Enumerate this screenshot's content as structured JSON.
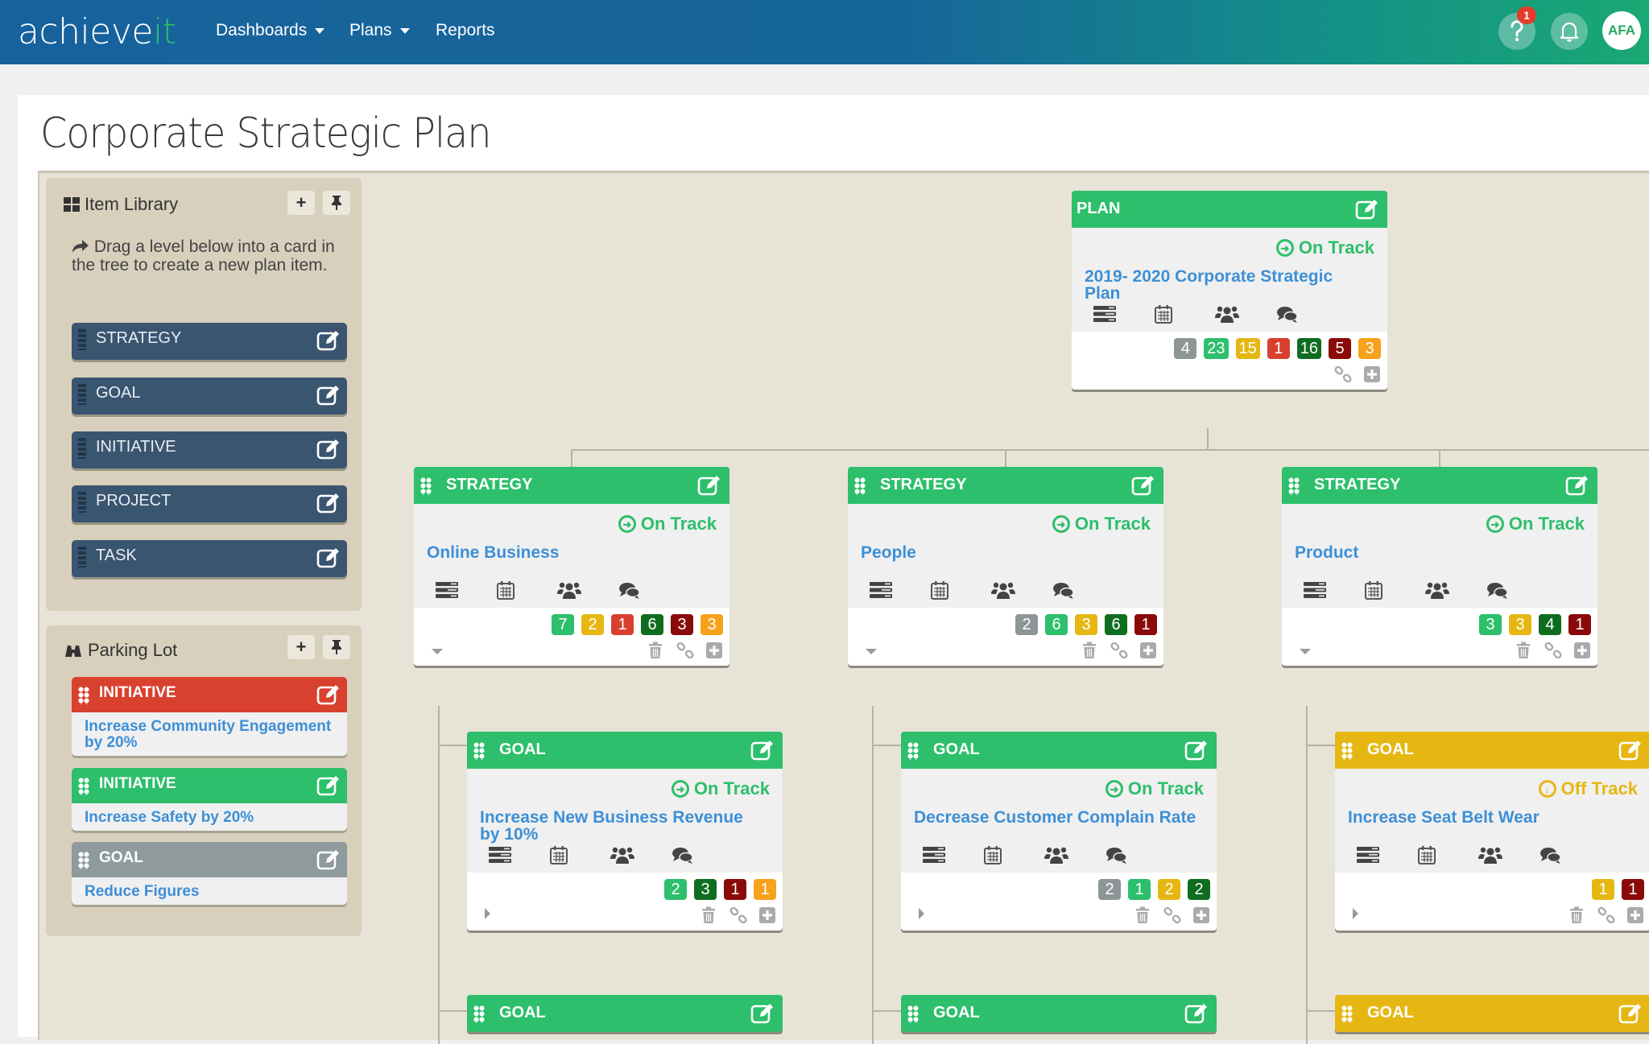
{
  "app": {
    "logo_main": "achieve",
    "logo_accent": "it",
    "nav": [
      {
        "label": "Dashboards",
        "has_dropdown": true
      },
      {
        "label": "Plans",
        "has_dropdown": true
      },
      {
        "label": "Reports",
        "has_dropdown": false
      }
    ],
    "help_badge": "1",
    "avatar_initials": "AFA"
  },
  "page": {
    "title": "Corporate Strategic Plan"
  },
  "colors": {
    "green": "#2dbf6b",
    "yellow": "#e6b713",
    "red": "#d9412f",
    "gray": "#8e9a9c",
    "navy": "#3a5570",
    "link_blue": "#3d8fd6",
    "count_gray": "#8e9596",
    "count_green": "#2dbf6b",
    "count_yellow": "#e6b713",
    "count_red": "#d7402f",
    "count_darkgreen": "#0f6d1f",
    "count_darkred": "#8a0a0a",
    "count_orange": "#f7a21b"
  },
  "item_library": {
    "title": "Item Library",
    "hint": "Drag a level below into a card in the tree to create a new plan item.",
    "levels": [
      "STRATEGY",
      "GOAL",
      "INITIATIVE",
      "PROJECT",
      "TASK"
    ]
  },
  "parking_lot": {
    "title": "Parking Lot",
    "items": [
      {
        "type": "INITIATIVE",
        "color": "red",
        "title": "Increase Community Engagement by 20%"
      },
      {
        "type": "INITIATIVE",
        "color": "green",
        "title": "Increase Safety by 20%"
      },
      {
        "type": "GOAL",
        "color": "gray",
        "title": "Reduce Figures"
      }
    ]
  },
  "tree": {
    "plan": {
      "type": "PLAN",
      "color": "green",
      "status": "On Track",
      "status_kind": "on",
      "title": "2019- 2020 Corporate Strategic Plan",
      "counts": [
        [
          "gray",
          4
        ],
        [
          "green",
          23
        ],
        [
          "yellow",
          15
        ],
        [
          "red",
          1
        ],
        [
          "darkgreen",
          16
        ],
        [
          "darkred",
          5
        ],
        [
          "orange",
          3
        ]
      ]
    },
    "strategies": [
      {
        "type": "STRATEGY",
        "color": "green",
        "status": "On Track",
        "status_kind": "on",
        "title": "Online Business",
        "counts": [
          [
            "green",
            7
          ],
          [
            "yellow",
            2
          ],
          [
            "red",
            1
          ],
          [
            "darkgreen",
            6
          ],
          [
            "darkred",
            3
          ],
          [
            "orange",
            3
          ]
        ]
      },
      {
        "type": "STRATEGY",
        "color": "green",
        "status": "On Track",
        "status_kind": "on",
        "title": "People",
        "counts": [
          [
            "gray",
            2
          ],
          [
            "green",
            6
          ],
          [
            "yellow",
            3
          ],
          [
            "darkgreen",
            6
          ],
          [
            "darkred",
            1
          ]
        ]
      },
      {
        "type": "STRATEGY",
        "color": "green",
        "status": "On Track",
        "status_kind": "on",
        "title": "Product",
        "counts": [
          [
            "green",
            3
          ],
          [
            "yellow",
            3
          ],
          [
            "darkgreen",
            4
          ],
          [
            "darkred",
            1
          ]
        ]
      }
    ],
    "goals": [
      {
        "type": "GOAL",
        "color": "green",
        "status": "On Track",
        "status_kind": "on",
        "title": "Increase New Business Revenue by 10%",
        "counts": [
          [
            "green",
            2
          ],
          [
            "darkgreen",
            3
          ],
          [
            "darkred",
            1
          ],
          [
            "orange",
            1
          ]
        ]
      },
      {
        "type": "GOAL",
        "color": "green",
        "status": "On Track",
        "status_kind": "on",
        "title": "Decrease Customer Complain Rate",
        "counts": [
          [
            "gray",
            2
          ],
          [
            "green",
            1
          ],
          [
            "yellow",
            2
          ],
          [
            "darkgreen",
            2
          ]
        ]
      },
      {
        "type": "GOAL",
        "color": "yellow",
        "status": "Off Track",
        "status_kind": "off",
        "title": "Increase Seat Belt Wear",
        "counts": [
          [
            "yellow",
            1
          ],
          [
            "darkred",
            1
          ]
        ]
      }
    ],
    "next_goals": [
      {
        "type": "GOAL",
        "color": "green"
      },
      {
        "type": "GOAL",
        "color": "green"
      },
      {
        "type": "GOAL",
        "color": "yellow"
      }
    ]
  }
}
